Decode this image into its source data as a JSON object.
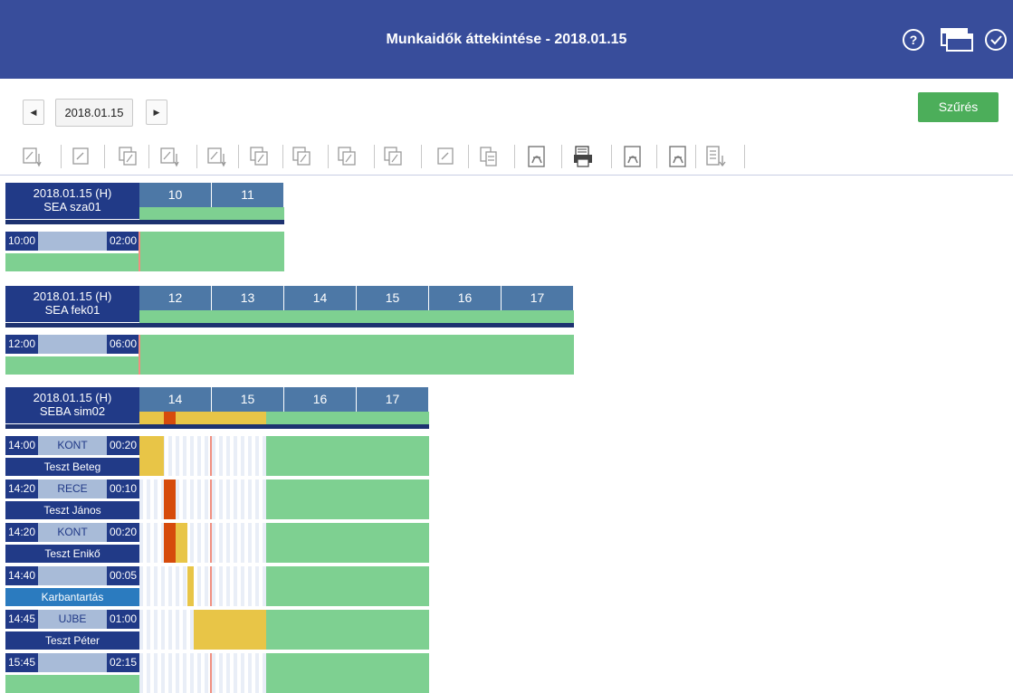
{
  "header": {
    "title": "Munkaidők áttekintése - 2018.01.15",
    "icons": [
      "help-icon",
      "windows-icon",
      "check-circle-icon"
    ],
    "bg": "#384d9b"
  },
  "datebar": {
    "date": "2018.01.15",
    "prev_glyph": "◀",
    "next_glyph": "▶",
    "filter_label": "Szűrés",
    "filter_color": "#4cae5a"
  },
  "toolbar": {
    "icons": [
      "edit-down-icon",
      "edit-icon",
      "copy-icon",
      "edit-add-down-icon",
      "edit-down-icon",
      "copy-add-icon",
      "copy-edit-icon",
      "copy-edit-add-icon",
      "copy-add-icon",
      "edit-icon",
      "document-copy-icon",
      "pdf-icon",
      "print-icon",
      "pdf-icon",
      "pdf-icon",
      "document-down-icon"
    ]
  },
  "days": [
    {
      "label": "2018.01.15 (H)",
      "resource": "SEA sza01",
      "hours": [
        "10",
        "11"
      ],
      "slots": [
        {
          "start": "10:00",
          "code": "",
          "duration": "02:00",
          "name": ""
        }
      ]
    },
    {
      "label": "2018.01.15 (H)",
      "resource": "SEA fek01",
      "hours": [
        "12",
        "13",
        "14",
        "15",
        "16",
        "17"
      ],
      "slots": [
        {
          "start": "12:00",
          "code": "",
          "duration": "06:00",
          "name": ""
        }
      ]
    },
    {
      "label": "2018.01.15 (H)",
      "resource": "SEBA sim02",
      "hours": [
        "14",
        "15",
        "16",
        "17"
      ],
      "slots": [
        {
          "start": "14:00",
          "code": "KONT",
          "duration": "00:20",
          "name": "Teszt Beteg"
        },
        {
          "start": "14:20",
          "code": "RECE",
          "duration": "00:10",
          "name": "Teszt János"
        },
        {
          "start": "14:20",
          "code": "KONT",
          "duration": "00:20",
          "name": "Teszt Enikő"
        },
        {
          "start": "14:40",
          "code": "",
          "duration": "00:05",
          "name": "Karbantartás"
        },
        {
          "start": "14:45",
          "code": "UJBE",
          "duration": "01:00",
          "name": "Teszt Péter"
        },
        {
          "start": "15:45",
          "code": "",
          "duration": "02:15",
          "name": ""
        }
      ]
    }
  ],
  "colors": {
    "navy": "#213a87",
    "hour_blue": "#4d78a6",
    "free_green": "#7ed091",
    "booked_yellow": "#e8c547",
    "overlap_red": "#d64b0c",
    "maintenance_blue": "#2b7bbf"
  }
}
